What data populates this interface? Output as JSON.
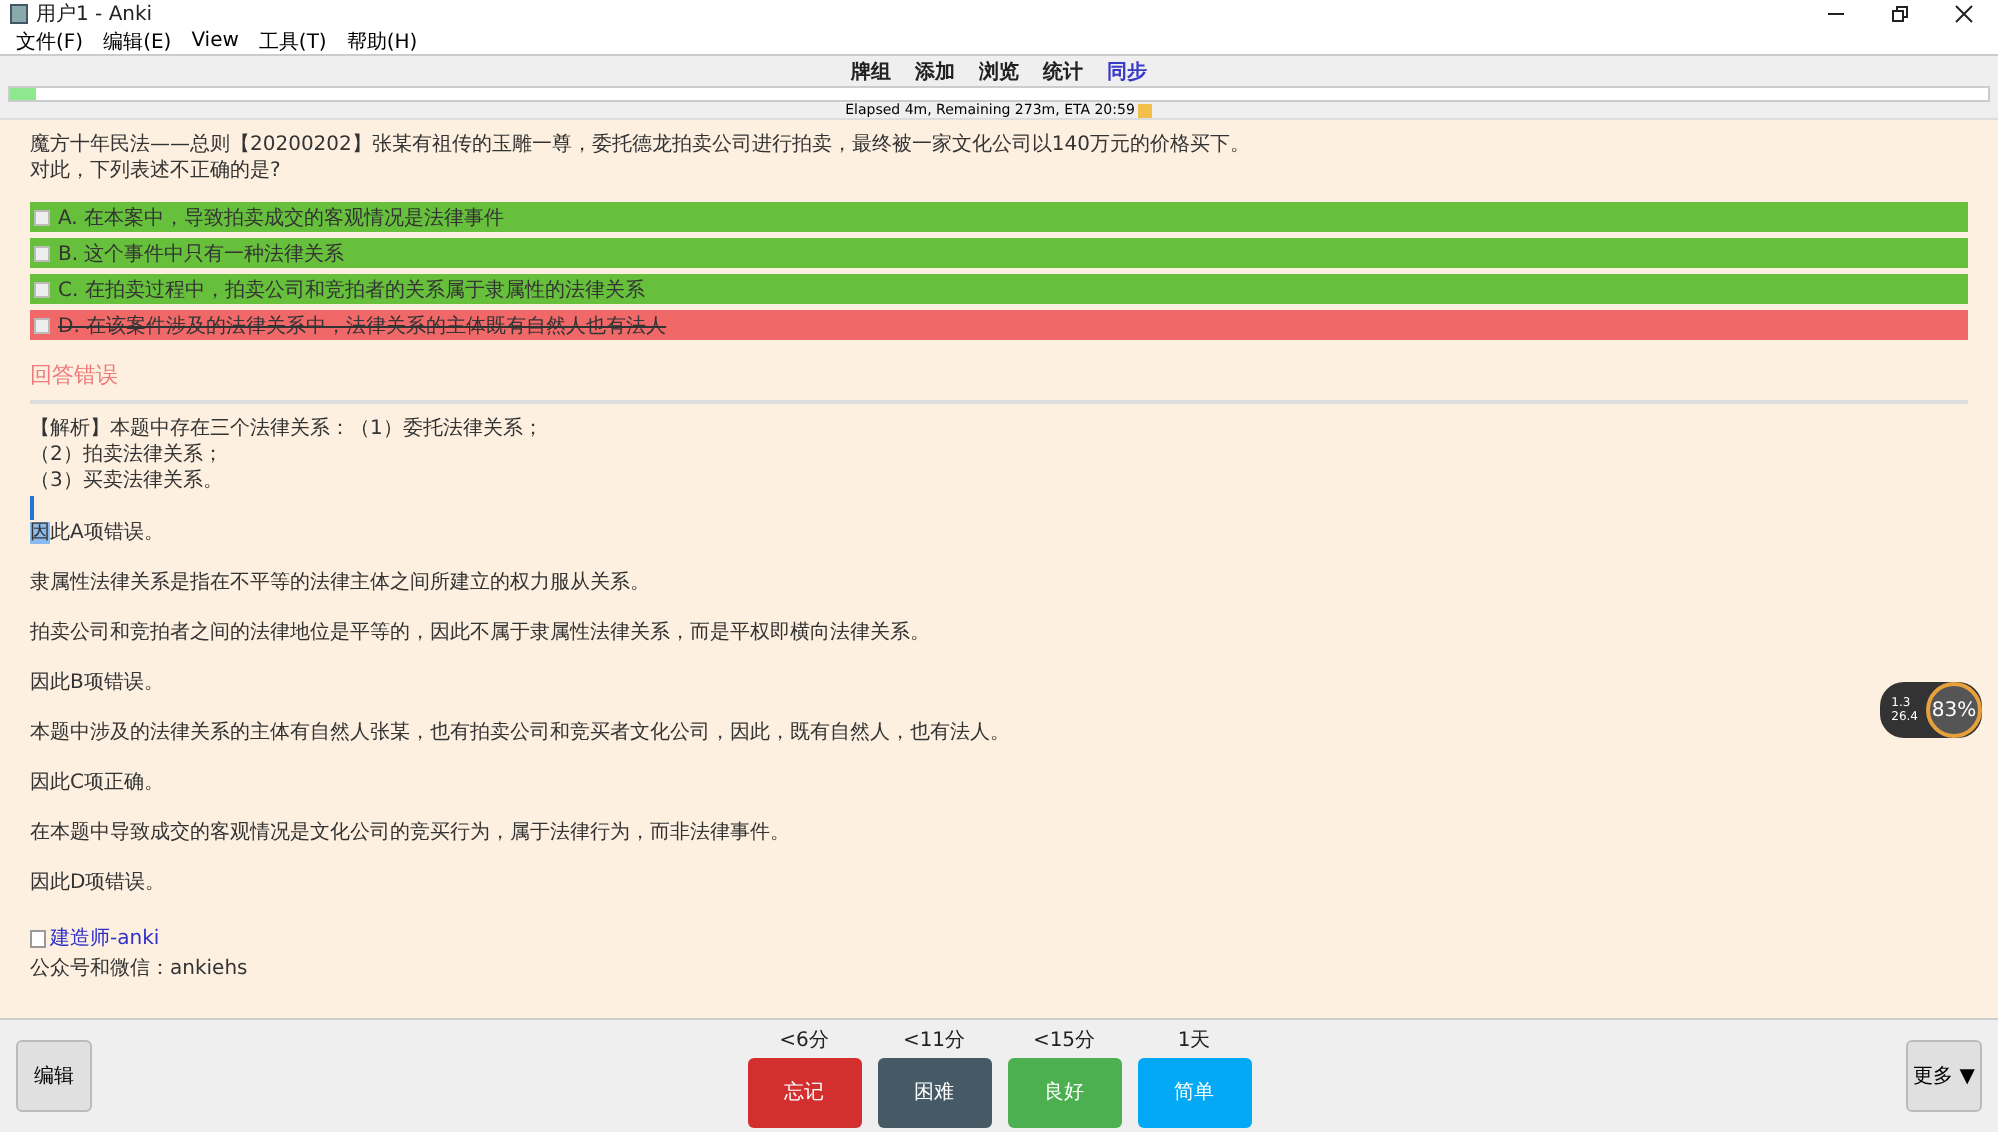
{
  "window": {
    "title": "用户1 - Anki"
  },
  "menu": [
    "文件(F)",
    "编辑(E)",
    "View",
    "工具(T)",
    "帮助(H)"
  ],
  "toolbar": [
    {
      "label": "牌组",
      "selected": false
    },
    {
      "label": "添加",
      "selected": false
    },
    {
      "label": "浏览",
      "selected": false
    },
    {
      "label": "统计",
      "selected": false
    },
    {
      "label": "同步",
      "selected": true
    }
  ],
  "progress": {
    "level": 0.013,
    "status": "Elapsed 4m, Remaining 273m, ETA 20:59"
  },
  "question": [
    "魔方十年民法——总则【20200202】张某有祖传的玉雕一尊，委托德龙拍卖公司进行拍卖，最终被一家文化公司以140万元的价格买下。",
    "对此，下列表述不正确的是?"
  ],
  "options": [
    {
      "text": "A. 在本案中，导致拍卖成交的客观情况是法律事件",
      "kind": "correct",
      "checked": false
    },
    {
      "text": "B. 这个事件中只有一种法律关系",
      "kind": "correct",
      "checked": false
    },
    {
      "text": "C. 在拍卖过程中，拍卖公司和竞拍者的关系属于隶属性的法律关系",
      "kind": "correct",
      "checked": false
    },
    {
      "text": "D. 在该案件涉及的法律关系中，法律关系的主体既有自然人也有法人",
      "kind": "wrong",
      "checked": false
    }
  ],
  "result": "回答错误",
  "analysis": [
    "【解析】本题中存在三个法律关系：（1）委托法律关系；",
    "（2）拍卖法律关系；",
    "（3）买卖法律关系。"
  ],
  "paragraphs": [
    {
      "highlight": "因",
      "text": "此A项错误。"
    },
    {
      "text": "隶属性法律关系是指在不平等的法律主体之间所建立的权力服从关系。"
    },
    {
      "text": "拍卖公司和竞拍者之间的法律地位是平等的，因此不属于隶属性法律关系，而是平权即横向法律关系。"
    },
    {
      "text": "因此B项错误。"
    },
    {
      "text": "本题中涉及的法律关系的主体有自然人张某，也有拍卖公司和竞买者文化公司，因此，既有自然人，也有法人。"
    },
    {
      "text": "因此C项正确。"
    },
    {
      "text": "在本题中导致成交的客观情况是文化公司的竞买行为，属于法律行为，而非法律事件。"
    },
    {
      "text": "因此D项错误。"
    }
  ],
  "image_link": "建造师-anki",
  "footer": "公众号和微信：ankiehs",
  "net_widget": {
    "up": "1.3",
    "down": "26.4",
    "percent": "83%"
  },
  "edit_button": "编辑",
  "answers": [
    {
      "label": "忘记",
      "interval": "<6分",
      "color": "#d32f2f"
    },
    {
      "label": "困难",
      "interval": "<11分",
      "color": "#455a64"
    },
    {
      "label": "良好",
      "interval": "<15分",
      "color": "#4caf50"
    },
    {
      "label": "简单",
      "interval": "1天",
      "color": "#03a9f4"
    }
  ],
  "more_button": "更多 ▼"
}
